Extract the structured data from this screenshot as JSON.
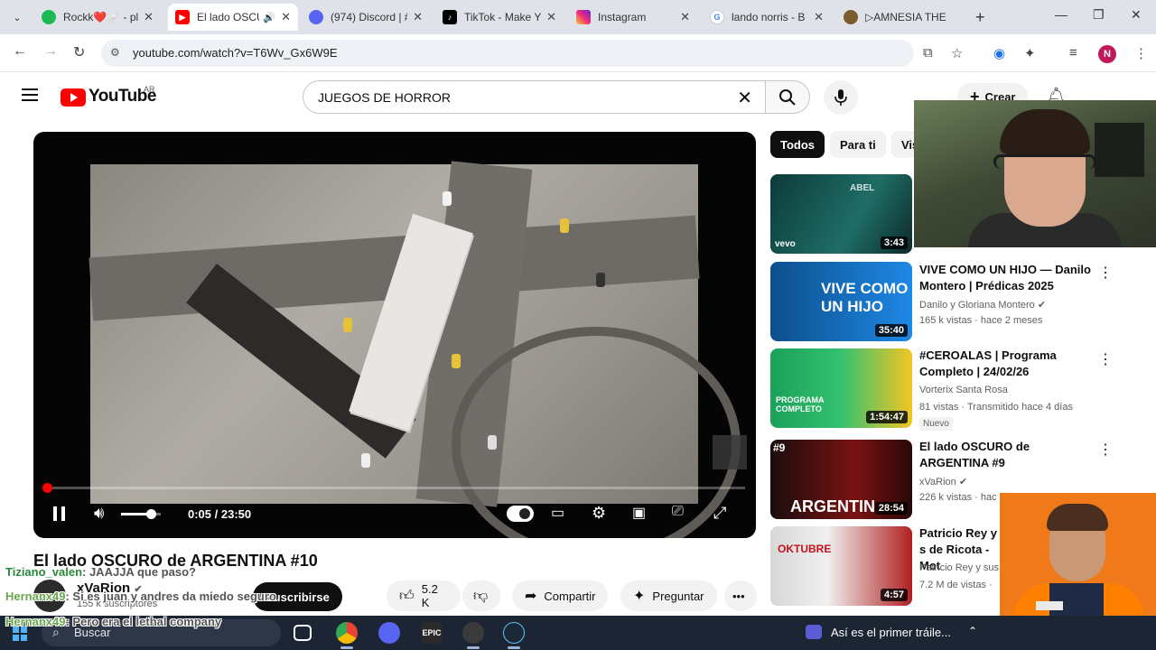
{
  "browser": {
    "tabs": [
      {
        "title": "Rockk❤️🩹 - pl",
        "favicon": "spotify-icon",
        "color": "#1db954"
      },
      {
        "title": "El lado OSCU",
        "favicon": "youtube-icon",
        "color": "#ff0000",
        "active": true
      },
      {
        "title": "(974) Discord | #",
        "favicon": "discord-icon",
        "color": "#5865f2"
      },
      {
        "title": "TikTok - Make Y",
        "favicon": "tiktok-icon",
        "color": "#000000"
      },
      {
        "title": "Instagram",
        "favicon": "instagram-icon",
        "color": "#e1306c"
      },
      {
        "title": "lando norris - B",
        "favicon": "google-icon",
        "color": "#4285f4"
      },
      {
        "title": "▷AMNESIA THE",
        "favicon": "amnesia-icon",
        "color": "#7a5c2e"
      }
    ],
    "url": "youtube.com/watch?v=T6Wv_Gx6W9E",
    "profile_initial": "N"
  },
  "youtube": {
    "brand": "YouTube",
    "country": "AR",
    "search_query": "JUEGOS DE HORROR",
    "create_label": "Crear"
  },
  "player": {
    "time": "0:05 / 23:50",
    "progress": 0.0035,
    "volume": 0.75
  },
  "video": {
    "title": "El lado OSCURO de ARGENTINA #10",
    "channel": "xVaRion",
    "subscribers": "155 k suscriptores",
    "subscribe_label": "Suscribirse",
    "likes": "5.2 K",
    "share_label": "Compartir",
    "ask_label": "Preguntar"
  },
  "chips": [
    "Todos",
    "Para ti",
    "Vis"
  ],
  "recommendations": [
    {
      "duration": "3:43",
      "thumb_text": "ABEL",
      "has_title": false
    },
    {
      "title": "VIVE COMO UN HIJO — Danilo Montero | Prédicas 2025",
      "channel": "Danilo y Gloriana Montero",
      "meta": "165 k vistas · hace 2 meses",
      "duration": "35:40",
      "thumb_text": "VIVE COMO UN HIJO"
    },
    {
      "title": "#CEROALAS | Programa Completo | 24/02/26",
      "channel": "Vorterix Santa Rosa",
      "meta": "81 vistas · Transmitido hace 4 días",
      "duration": "1:54:47",
      "badge": "Nuevo",
      "thumb_text": "PROGRAMA COMPLETO"
    },
    {
      "title": "El lado OSCURO de ARGENTINA #9",
      "channel": "xVaRion",
      "meta": "226 k vistas · hac",
      "duration": "28:54",
      "thumb_text": "ARGENTIN"
    },
    {
      "title": "Patricio Rey y s de Ricota - Mot",
      "channel": "Patricio Rey y sus",
      "meta": "7.2 M de vistas ·",
      "duration": "4:57",
      "thumb_text": "OKTUBRE"
    }
  ],
  "chat": [
    {
      "user": "Tiziano_valen",
      "message": ": JAAJJA que paso?"
    },
    {
      "user": "Hernanx49",
      "message": ": Si es juan y andres da miedo seguro"
    },
    {
      "user": "Hernanx49",
      "message": ": Pero era el lethal company"
    }
  ],
  "taskbar": {
    "search_label": "Buscar",
    "now_playing": "Así es el primer tráile..."
  }
}
